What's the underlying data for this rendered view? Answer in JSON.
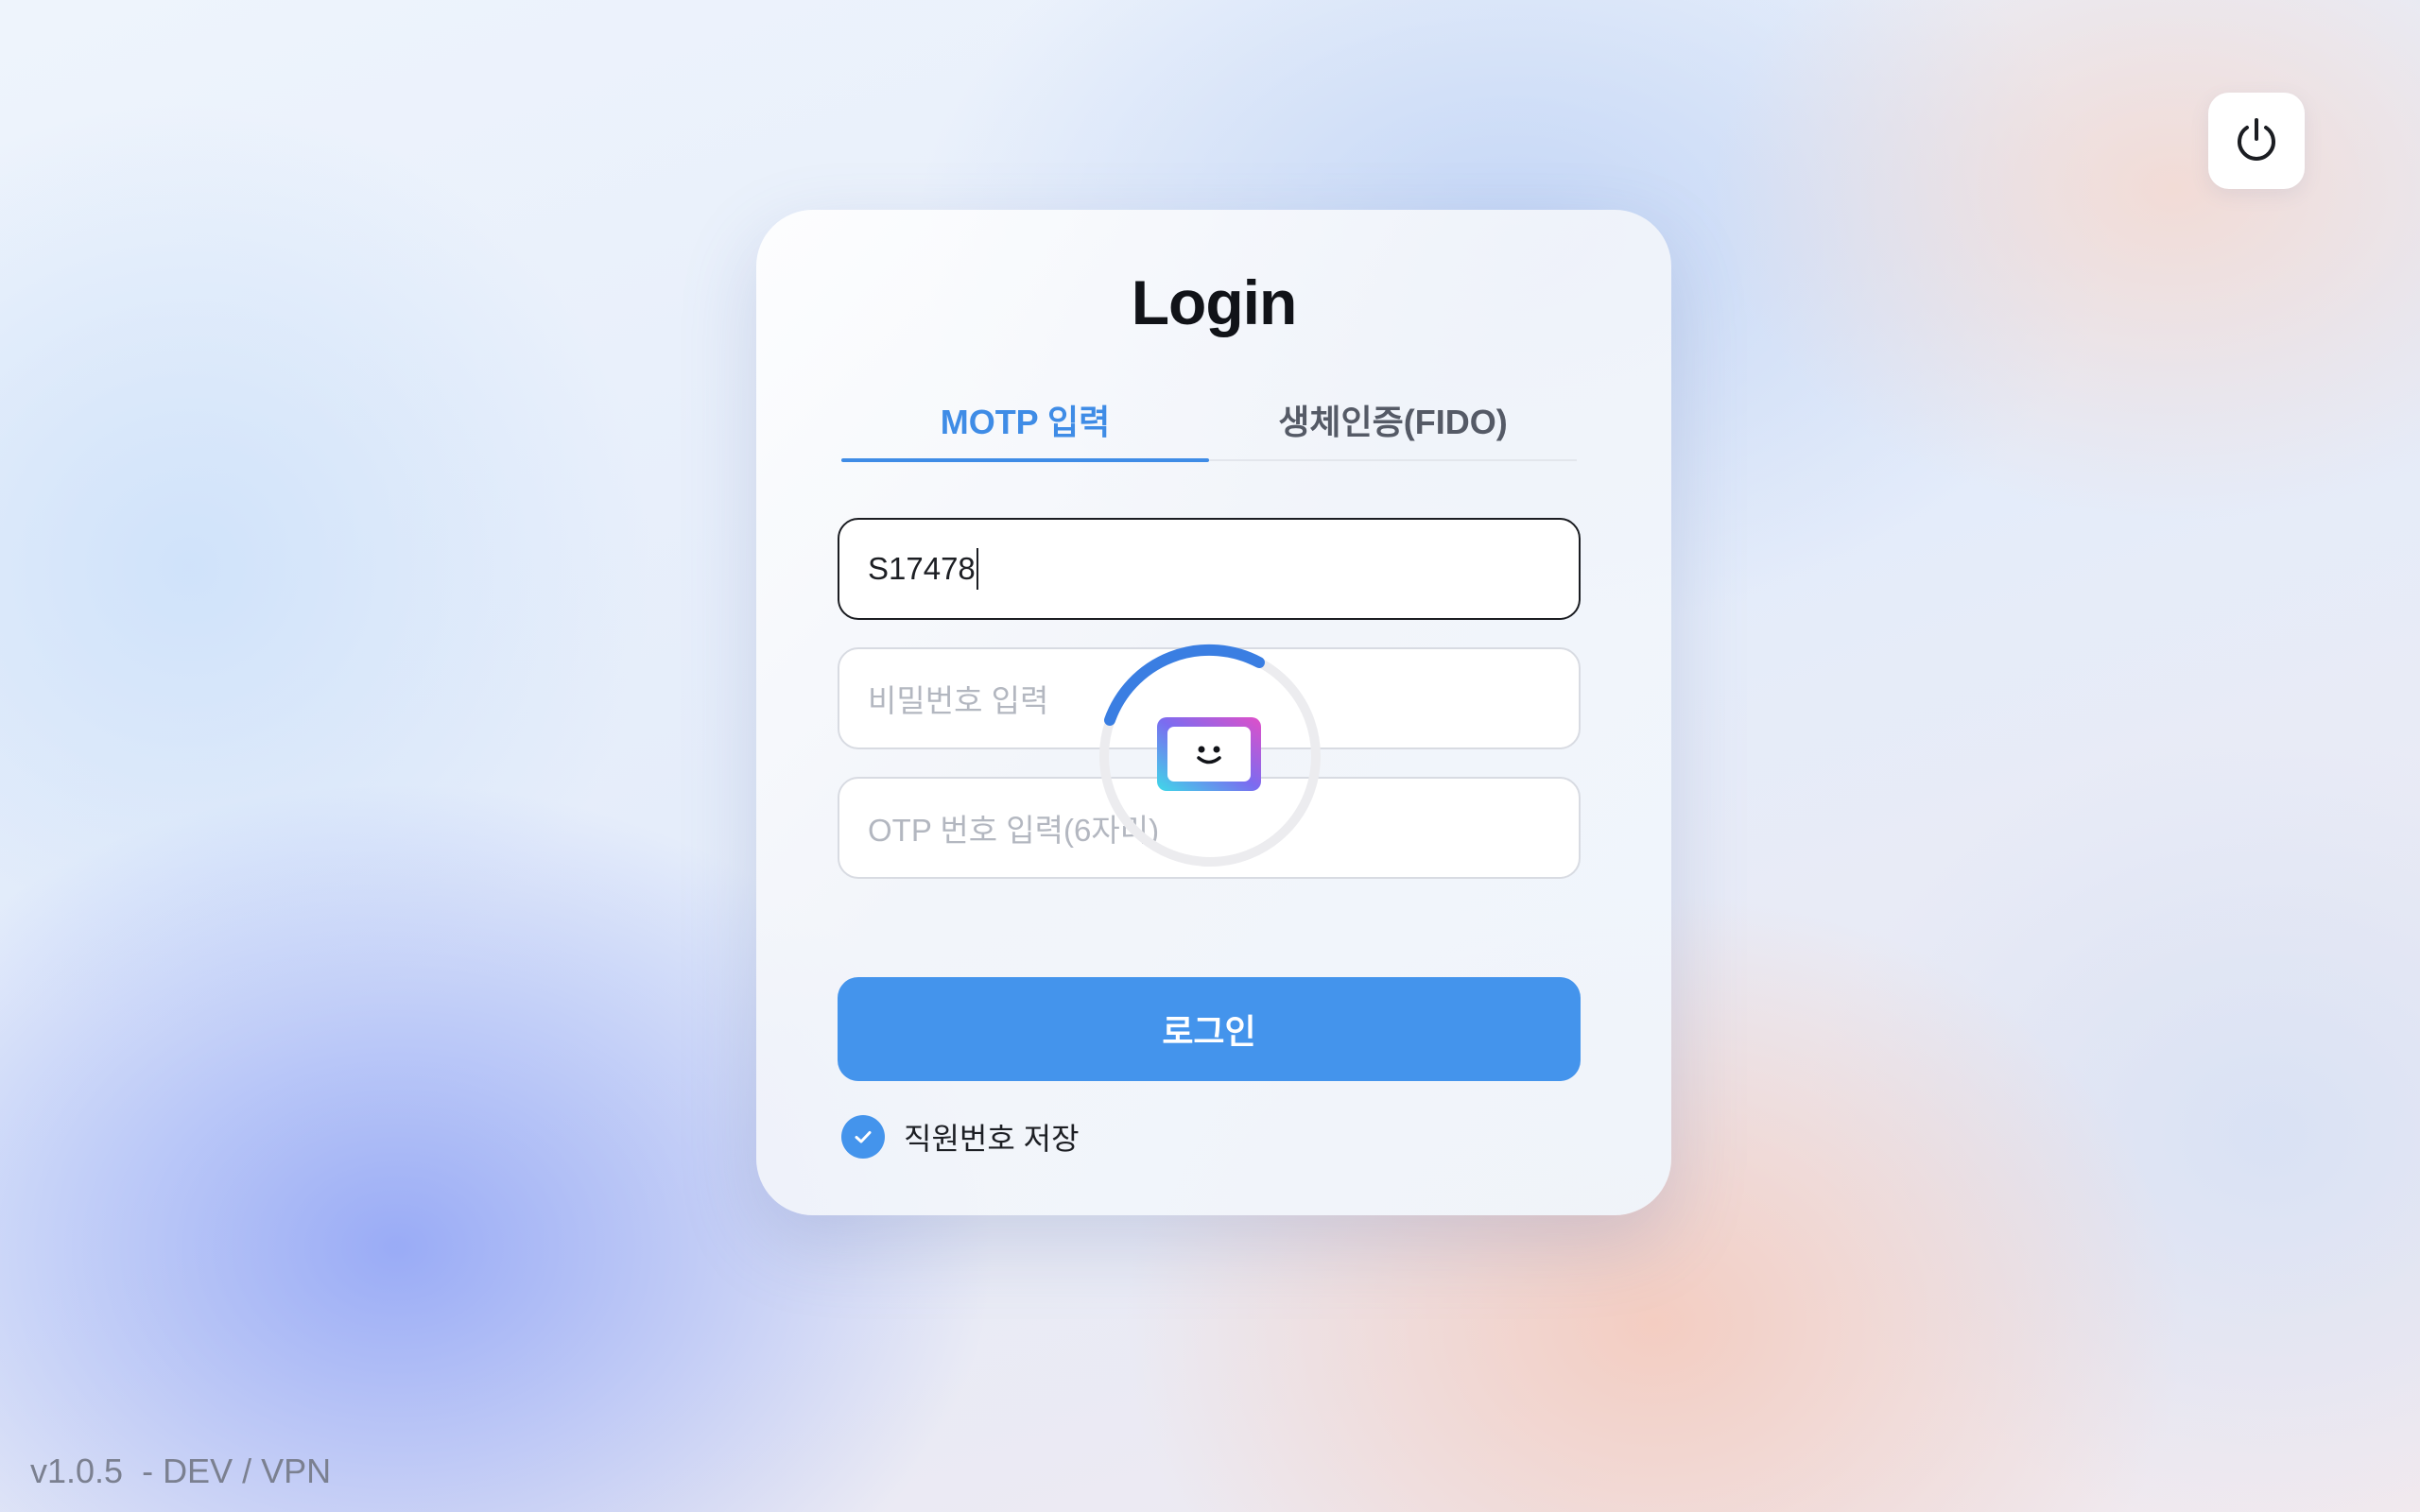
{
  "power_button": {
    "icon": "power-icon"
  },
  "login": {
    "title": "Login",
    "tabs": [
      {
        "label": "MOTP 입력",
        "active": true
      },
      {
        "label": "생체인증(FIDO)",
        "active": false
      }
    ],
    "employee_id": {
      "value": "S17478"
    },
    "password": {
      "placeholder": "비밀번호 입력"
    },
    "otp": {
      "placeholder": "OTP 번호 입력(6자리)"
    },
    "submit_label": "로그인",
    "remember": {
      "label": "직원번호 저장",
      "checked": true
    }
  },
  "loading_indicator": {
    "icon": "smiley-app-icon"
  },
  "footer": {
    "version": "v1.0.5  - DEV / VPN"
  },
  "colors": {
    "accent": "#4494ec",
    "tab_active": "#3f8ce6",
    "text": "#111318"
  }
}
